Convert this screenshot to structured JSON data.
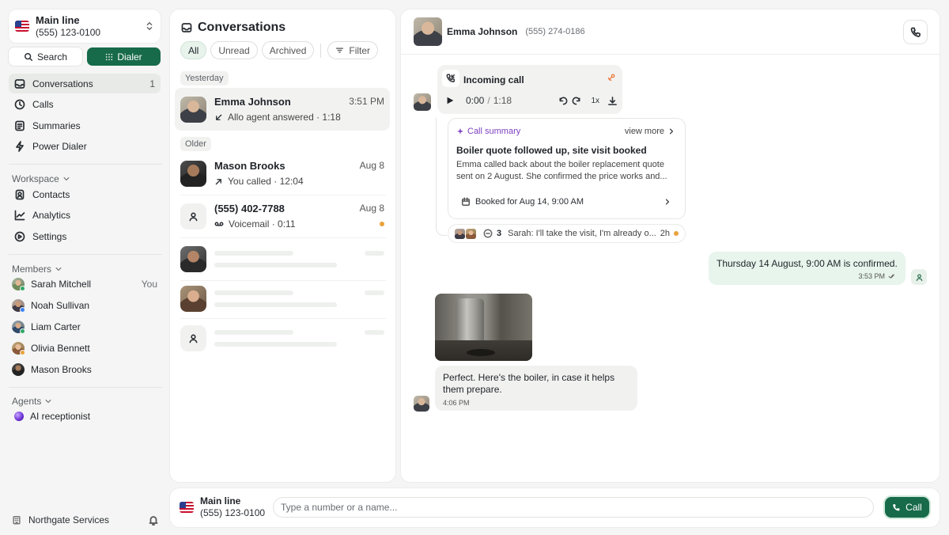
{
  "sidebar": {
    "line": {
      "name": "Main line",
      "number": "(555) 123-0100"
    },
    "search_label": "Search",
    "dialer_label": "Dialer",
    "nav": [
      {
        "label": "Conversations",
        "count": "1"
      },
      {
        "label": "Calls"
      },
      {
        "label": "Summaries"
      },
      {
        "label": "Power Dialer"
      }
    ],
    "workspace": {
      "heading": "Workspace",
      "items": [
        {
          "label": "Contacts"
        },
        {
          "label": "Analytics"
        },
        {
          "label": "Settings"
        }
      ]
    },
    "members": {
      "heading": "Members",
      "you_label": "You",
      "items": [
        {
          "name": "Sarah Mitchell",
          "status_color": "#2fa866"
        },
        {
          "name": "Noah Sullivan",
          "status_color": "#3b82f6"
        },
        {
          "name": "Liam Carter",
          "status_color": "#2fa866"
        },
        {
          "name": "Olivia Bennett",
          "status_color": "#e9a23b"
        },
        {
          "name": "Mason Brooks",
          "status_color": "#9aa0a6"
        }
      ]
    },
    "agents": {
      "heading": "Agents",
      "items": [
        {
          "name": "AI receptionist"
        }
      ]
    },
    "org_name": "Northgate Services"
  },
  "conversations": {
    "title": "Conversations",
    "filters": [
      "All",
      "Unread",
      "Archived"
    ],
    "filter_button": "Filter",
    "group_yesterday": "Yesterday",
    "group_older": "Older",
    "items": [
      {
        "name": "Emma Johnson",
        "time": "3:51 PM",
        "sub": "Allo agent answered · 1:18"
      },
      {
        "name": "Mason Brooks",
        "time": "Aug 8",
        "sub": "You called · 12:04"
      },
      {
        "name": "(555) 402-7788",
        "time": "Aug 8",
        "sub": "Voicemail · 0:11"
      }
    ]
  },
  "chat": {
    "contact_name": "Emma Johnson",
    "contact_number": "(555) 274-0186",
    "call": {
      "title": "Incoming call",
      "position": "0:00",
      "duration": "1:18",
      "speed": "1x"
    },
    "summary": {
      "label": "Call summary",
      "view_more": "view more",
      "headline": "Boiler quote followed up, site visit booked",
      "body": "Emma called back about the boiler replacement quote sent on 2 August. She confirmed the price works and...",
      "booking": "Booked for Aug 14, 9:00 AM"
    },
    "thread": {
      "count": "3",
      "preview": "Sarah: I'll take the visit, I'm already o...",
      "age": "2h"
    },
    "outgoing": {
      "text": "Thursday 14 August, 9:00 AM is confirmed.",
      "time": "3:53 PM"
    },
    "incoming": {
      "text": "Perfect. Here's the boiler, in case it helps them prepare.",
      "time": "4:06 PM"
    }
  },
  "bottombar": {
    "line_name": "Main line",
    "line_number": "(555) 123-0100",
    "input_placeholder": "Type a number or a name...",
    "call_label": "Call"
  }
}
